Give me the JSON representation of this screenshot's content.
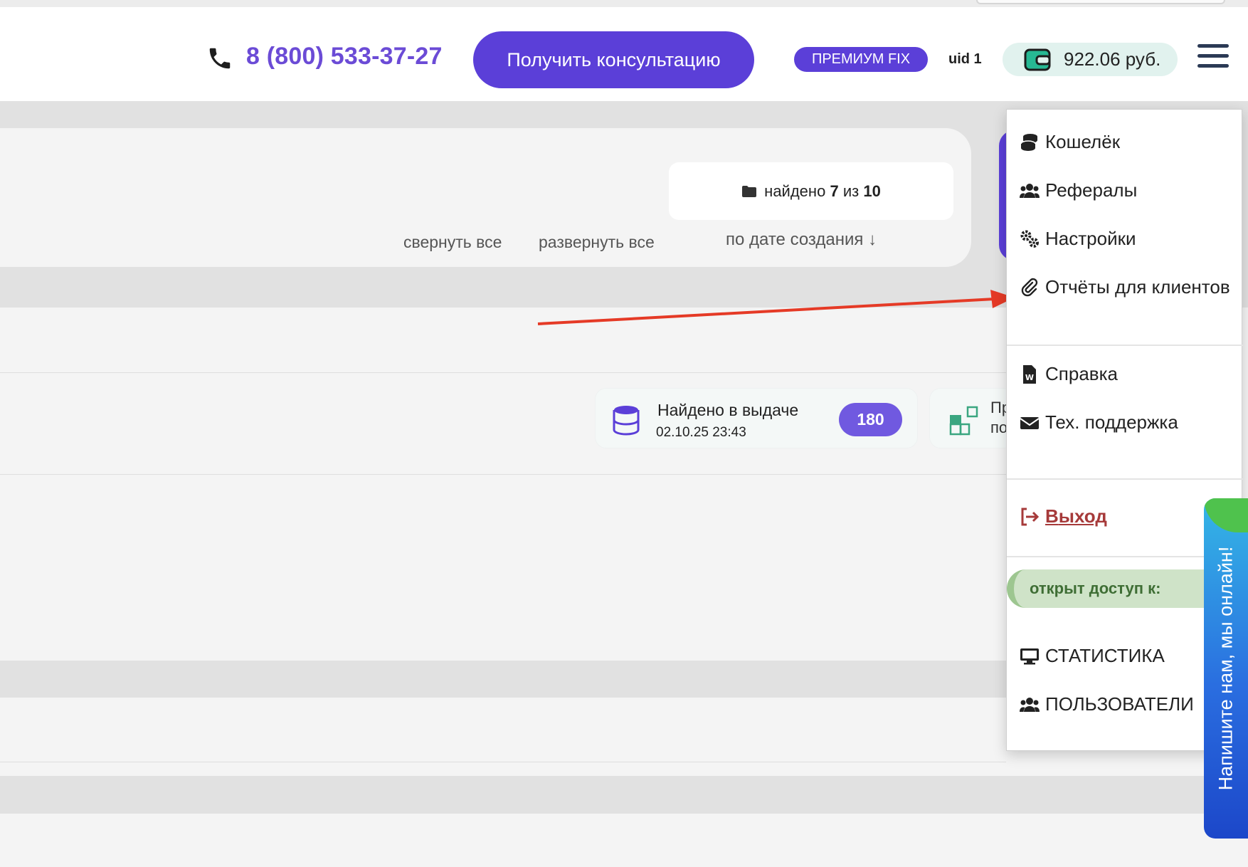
{
  "header": {
    "phone": "8 (800) 533-37-27",
    "consult_button": "Получить консультацию",
    "plan_badge": "ПРЕМИУМ FIX",
    "uid": "uid 1",
    "balance": "922.06 руб."
  },
  "panel": {
    "found_prefix": "найдено",
    "found_count": "7",
    "found_of": "из",
    "found_total": "10",
    "collapse_all": "свернуть все",
    "expand_all": "развернуть все",
    "sort": "по дате создания ↓"
  },
  "result_card": {
    "title": "Найдено в выдаче",
    "date": "02.10.25 23:43",
    "count": "180"
  },
  "card2": {
    "line1": "Пр",
    "line2": "по"
  },
  "menu": {
    "wallet": "Кошелёк",
    "referrals": "Рефералы",
    "settings": "Настройки",
    "client_reports": "Отчёты для клиентов",
    "help": "Справка",
    "support": "Тех. поддержка",
    "logout_first": "В",
    "logout_rest": "ыход",
    "access": "открыт доступ к:",
    "statistics": "СТАТИСТИКА",
    "users": "ПОЛЬЗОВАТЕЛИ"
  },
  "chat": {
    "label": "Напишите нам, мы онлайн!"
  },
  "colors": {
    "accent": "#5b3fd8",
    "annotation_arrow": "#e53a26",
    "logout": "#a63a3a"
  }
}
